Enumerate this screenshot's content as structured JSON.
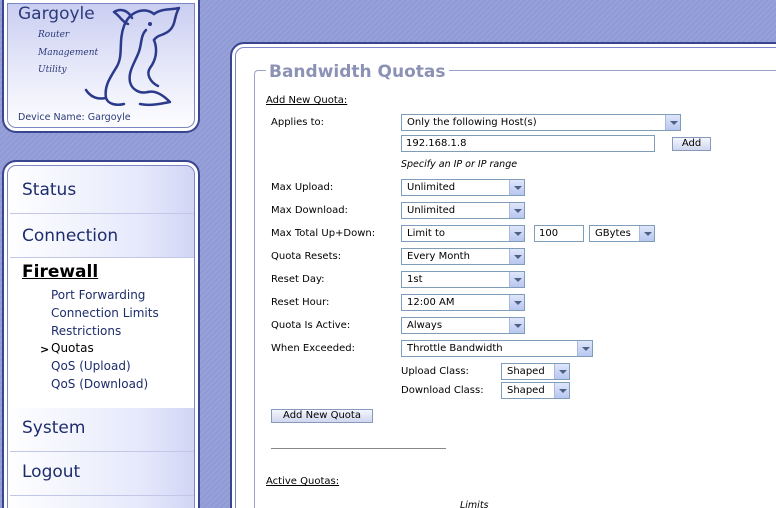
{
  "logo": {
    "title": "Gargoyle",
    "subtitle_lines": [
      "Router",
      "Management",
      "Utility"
    ],
    "device_name_label": "Device Name: Gargoyle"
  },
  "nav": {
    "status": "Status",
    "connection": "Connection",
    "firewall": "Firewall",
    "firewall_items": [
      "Port Forwarding",
      "Connection Limits",
      "Restrictions",
      "Quotas",
      "QoS (Upload)",
      "QoS (Download)"
    ],
    "active_arrow": ">",
    "system": "System",
    "logout": "Logout"
  },
  "panel": {
    "title": "Bandwidth Quotas",
    "add_new_quota_heading": "Add New Quota:",
    "applies_to_label": "Applies to:",
    "applies_to_value": "Only the following Host(s)",
    "host_value": "192.168.1.8",
    "add_button": "Add",
    "hint": "Specify an IP or IP range",
    "max_upload_label": "Max Upload:",
    "max_upload_value": "Unlimited",
    "max_download_label": "Max Download:",
    "max_download_value": "Unlimited",
    "max_total_label": "Max Total Up+Down:",
    "max_total_value": "Limit to",
    "max_total_amount": "100",
    "max_total_unit": "GBytes",
    "quota_resets_label": "Quota Resets:",
    "quota_resets_value": "Every Month",
    "reset_day_label": "Reset Day:",
    "reset_day_value": "1st",
    "reset_hour_label": "Reset Hour:",
    "reset_hour_value": "12:00 AM",
    "quota_active_label": "Quota Is Active:",
    "quota_active_value": "Always",
    "when_exceeded_label": "When Exceeded:",
    "when_exceeded_value": "Throttle Bandwidth",
    "upload_class_label": "Upload Class:",
    "upload_class_value": "Shaped",
    "download_class_label": "Download Class:",
    "download_class_value": "Shaped",
    "add_new_quota_button": "Add New Quota",
    "active_quotas_heading": "Active Quotas:",
    "limits_header": "Limits"
  },
  "colors": {
    "background": "#8f9ad6",
    "border": "#3a458f",
    "title": "#8c92b5",
    "nav_text": "#1d2d6b"
  }
}
